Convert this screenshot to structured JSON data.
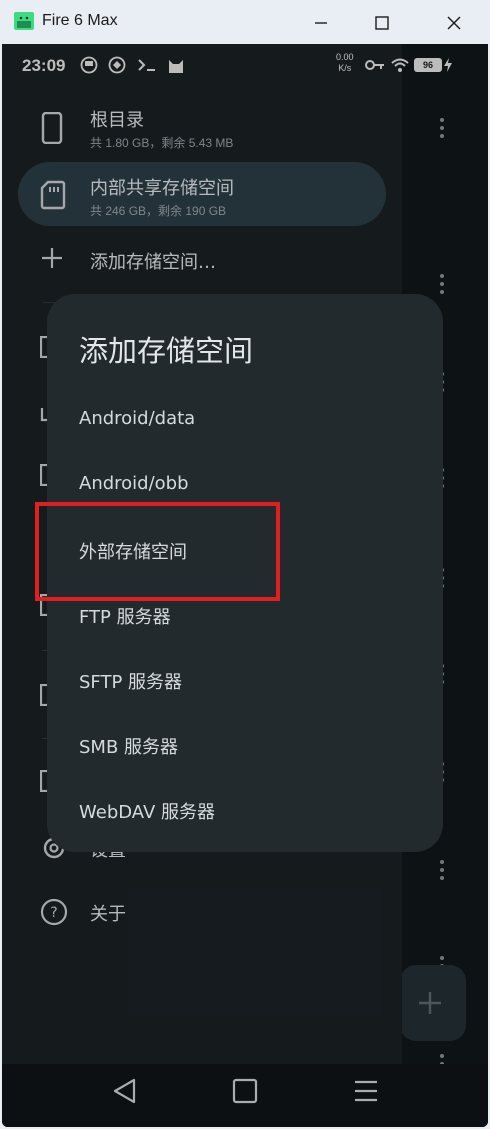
{
  "window": {
    "title": "Fire 6 Max",
    "icon": "android-icon",
    "colors": {
      "chrome": "#e9eef4",
      "close_x": "#1b1b1b"
    }
  },
  "statusbar": {
    "time": "23:09",
    "speed_value": "0.00",
    "speed_unit": "K/s",
    "battery": "96",
    "icons": [
      "app-icon-1",
      "app-icon-2",
      "terminal-icon",
      "cat-icon",
      "key-icon",
      "wifi-icon",
      "battery-icon",
      "bolt-icon"
    ]
  },
  "drawer": {
    "items": [
      {
        "title": "根目录",
        "subtitle": "共 1.80 GB，剩余 5.43 MB",
        "icon": "phone-icon",
        "selected": false
      },
      {
        "title": "内部共享存储空间",
        "subtitle": "共 246 GB，剩余 190 GB",
        "icon": "sd-card-icon",
        "selected": true
      },
      {
        "title": "添加存储空间…",
        "icon": "plus-icon",
        "selected": false
      }
    ],
    "settings_label": "设置",
    "about_label": "关于"
  },
  "dialog": {
    "title": "添加存储空间",
    "options": [
      "Android/data",
      "Android/obb",
      "外部存储空间",
      "FTP 服务器",
      "SFTP 服务器",
      "SMB 服务器",
      "WebDAV 服务器"
    ],
    "highlighted_option": "外部存储空间",
    "highlight_color": "#e02020"
  },
  "navbar": {
    "icons": [
      "back-icon",
      "home-icon",
      "menu-icon"
    ]
  },
  "colors": {
    "accent_selected": "#2b3e45",
    "dialog_bg": "#232a2d",
    "drawer_bg": "#1a2124"
  }
}
